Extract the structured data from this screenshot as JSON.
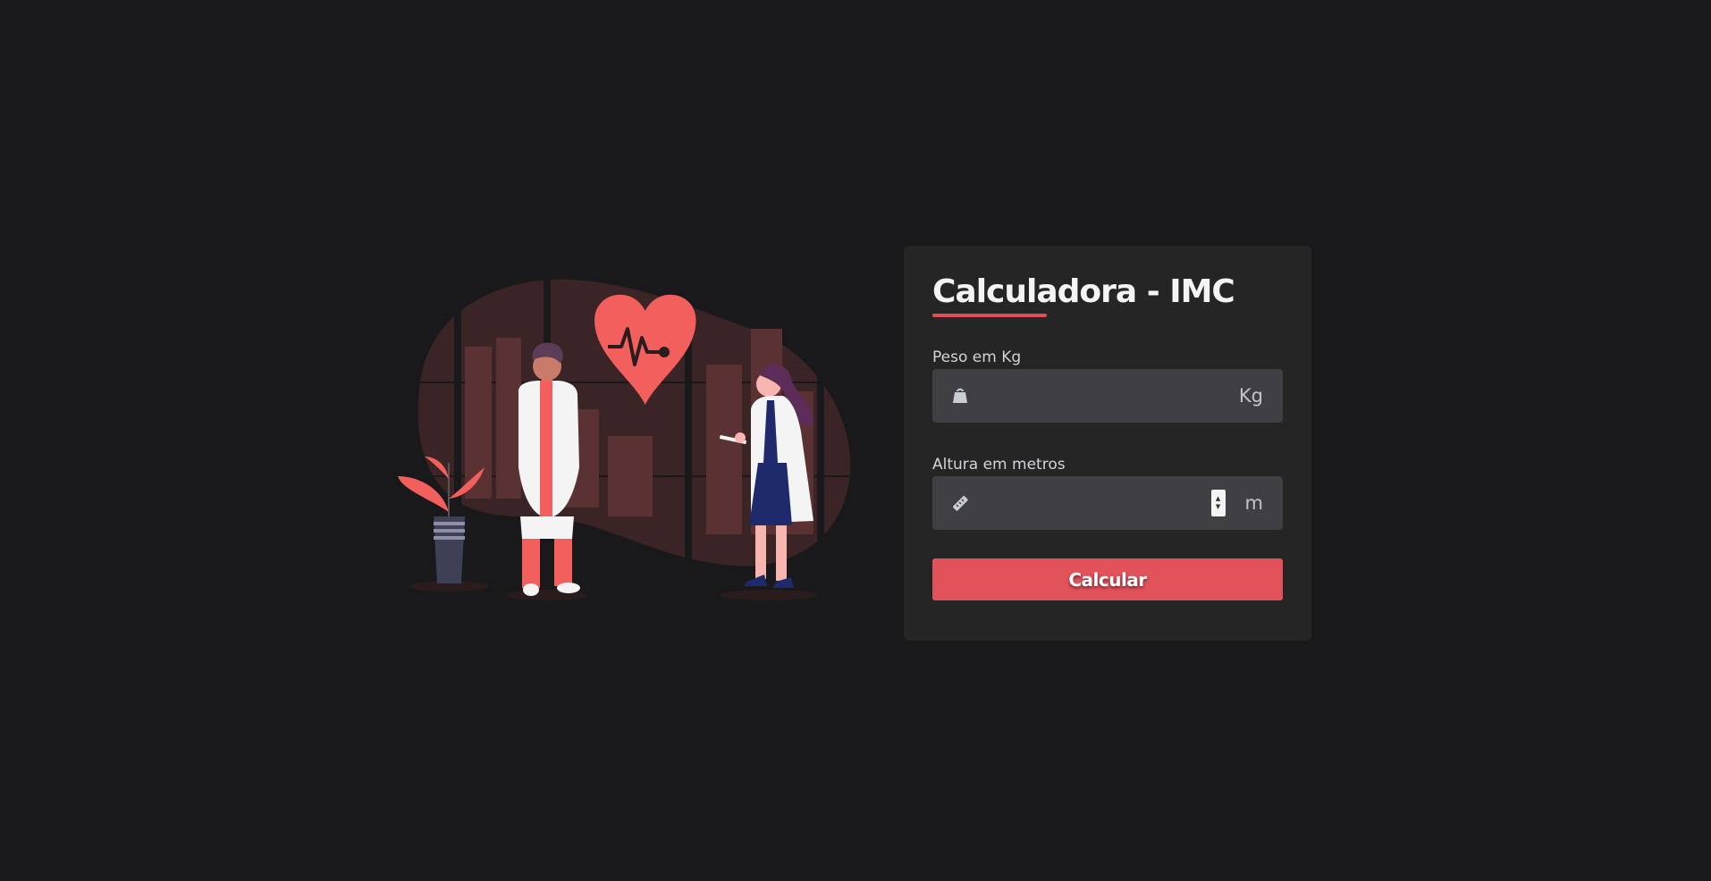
{
  "illustration": {
    "icon": "doctors-heart-illustration"
  },
  "card": {
    "title": "Calculadora - IMC",
    "weight": {
      "label": "Peso em Kg",
      "value": "",
      "unit": "Kg",
      "icon": "weight-bag-icon"
    },
    "height": {
      "label": "Altura em metros",
      "value": "",
      "unit": "m",
      "icon": "ruler-icon"
    },
    "button_label": "Calcular"
  },
  "colors": {
    "background": "#19191b",
    "card": "#252526",
    "input": "#3f3f44",
    "accent": "#e2525a"
  }
}
